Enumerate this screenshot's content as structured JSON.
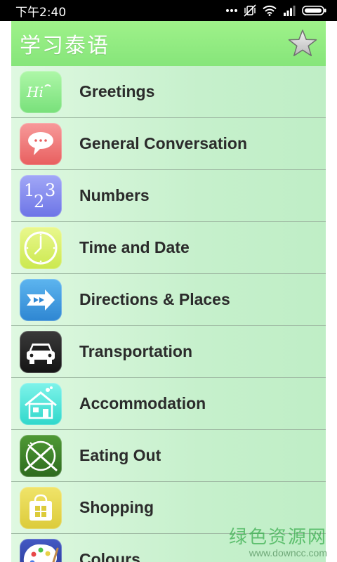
{
  "status_bar": {
    "time": "下午2:40",
    "icons": [
      "more-dots-icon",
      "mute-vibrate-icon",
      "wifi-icon",
      "signal-icon",
      "battery-icon"
    ]
  },
  "app_bar": {
    "title": "学习泰语",
    "favorite_icon": "star-icon"
  },
  "categories": [
    {
      "label": "Greetings",
      "icon": "hi-bubble-icon",
      "color": "#8af08a"
    },
    {
      "label": "General Conversation",
      "icon": "speech-bubble-icon",
      "color": "#f07070"
    },
    {
      "label": "Numbers",
      "icon": "numbers-123-icon",
      "color": "#7f86ef"
    },
    {
      "label": "Time and Date",
      "icon": "clock-icon",
      "color": "#d8f06a"
    },
    {
      "label": "Directions & Places",
      "icon": "arrow-sign-icon",
      "color": "#3f9de0"
    },
    {
      "label": "Transportation",
      "icon": "car-icon",
      "color": "#2a2a2a"
    },
    {
      "label": "Accommodation",
      "icon": "house-icon",
      "color": "#3fe6d8"
    },
    {
      "label": "Eating Out",
      "icon": "plate-cutlery-icon",
      "color": "#3f8a2a"
    },
    {
      "label": "Shopping",
      "icon": "shopping-bag-icon",
      "color": "#e6d84a"
    },
    {
      "label": "Colours",
      "icon": "palette-icon",
      "color": "#2e44a8"
    }
  ],
  "watermark": {
    "line1": "绿色资源网",
    "line2": "www.downcc.com"
  }
}
